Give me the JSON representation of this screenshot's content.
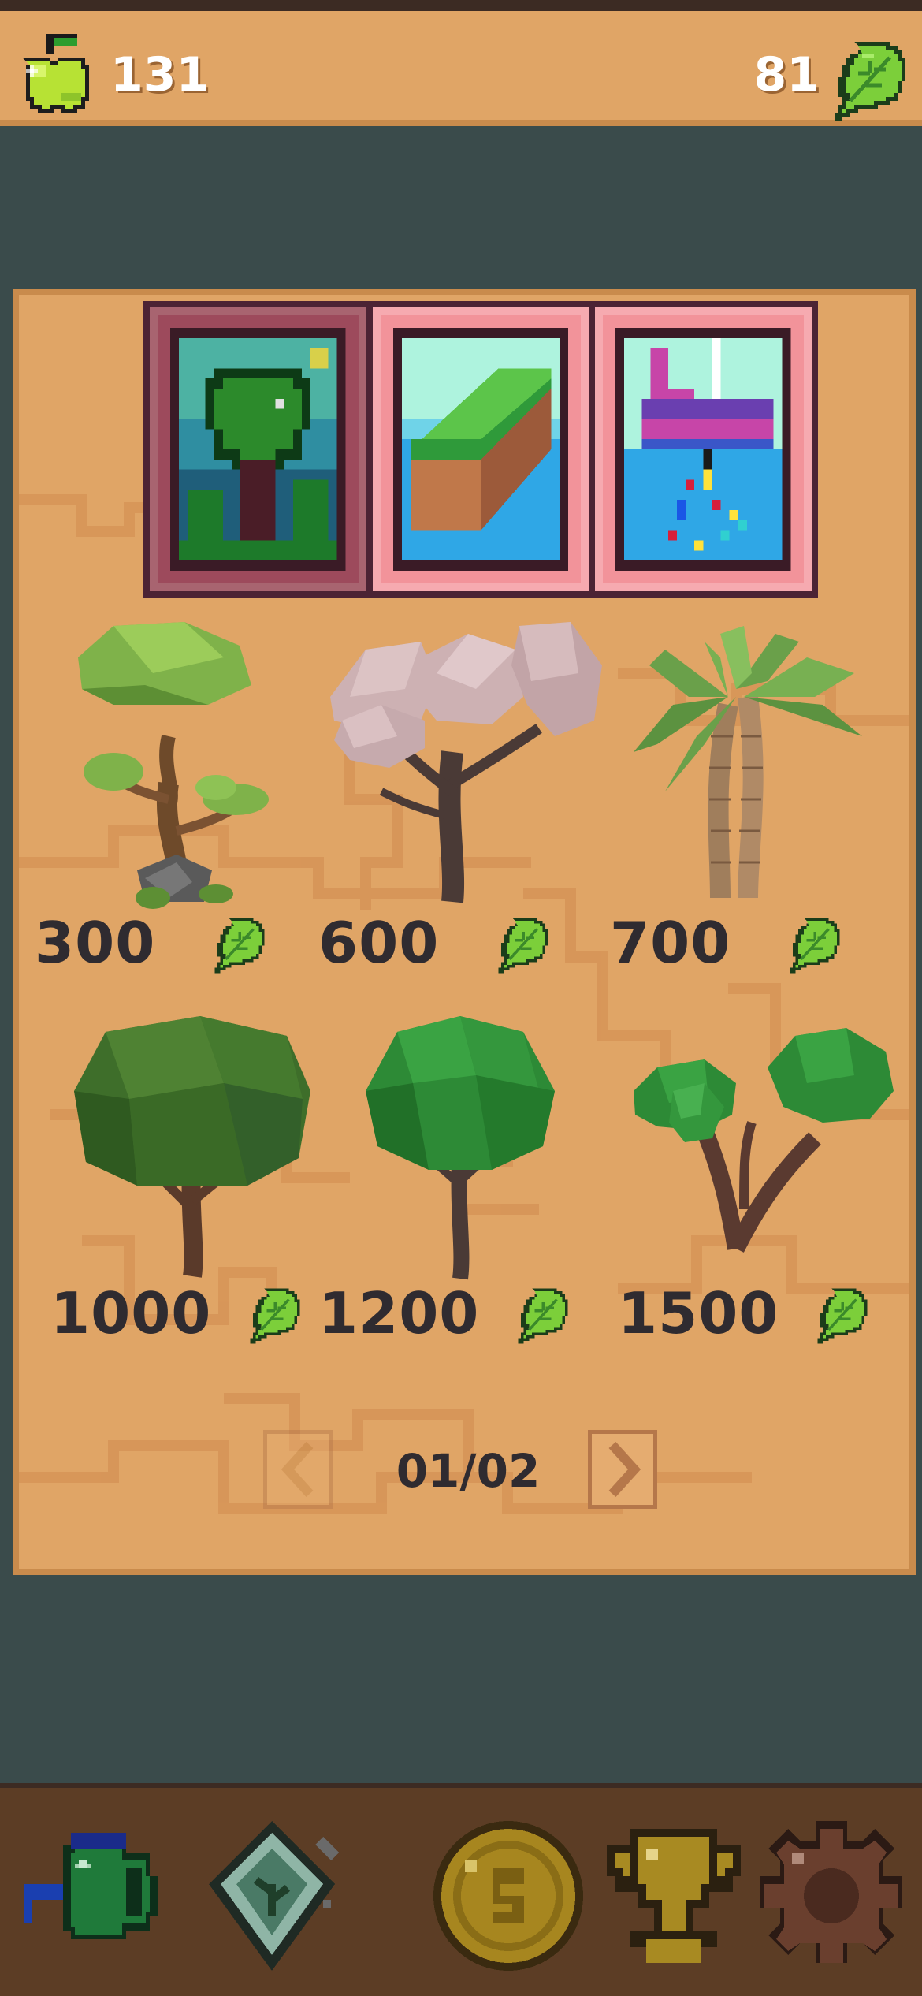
{
  "header": {
    "apples_count": "131",
    "leaves_count": "81",
    "apple_icon": "apple-icon",
    "leaf_icon": "leaf-icon"
  },
  "categories": [
    {
      "name": "tree-category-icon",
      "selected": true
    },
    {
      "name": "terrain-category-icon",
      "selected": false
    },
    {
      "name": "decoration-category-icon",
      "selected": false
    }
  ],
  "trees": [
    {
      "price": "300",
      "kind": "bonsai"
    },
    {
      "price": "600",
      "kind": "pink-blossom"
    },
    {
      "price": "700",
      "kind": "palm"
    },
    {
      "price": "1000",
      "kind": "wide-oak"
    },
    {
      "price": "1200",
      "kind": "round-tree"
    },
    {
      "price": "1500",
      "kind": "twin-branch"
    }
  ],
  "pager": {
    "page_label": "01/02"
  },
  "toolbar": [
    "watering-can-icon",
    "seed-packet-icon",
    "coin-icon",
    "trophy-icon",
    "gear-icon"
  ],
  "colors": {
    "wood": "#e0a566",
    "wood_border": "#c98b4c",
    "background": "#3a4b4b",
    "tab_pink": "#f2939a",
    "tab_selected": "#9d4a5c",
    "leaf_green": "#7ccf3a",
    "text_dark": "#2f2b30"
  }
}
